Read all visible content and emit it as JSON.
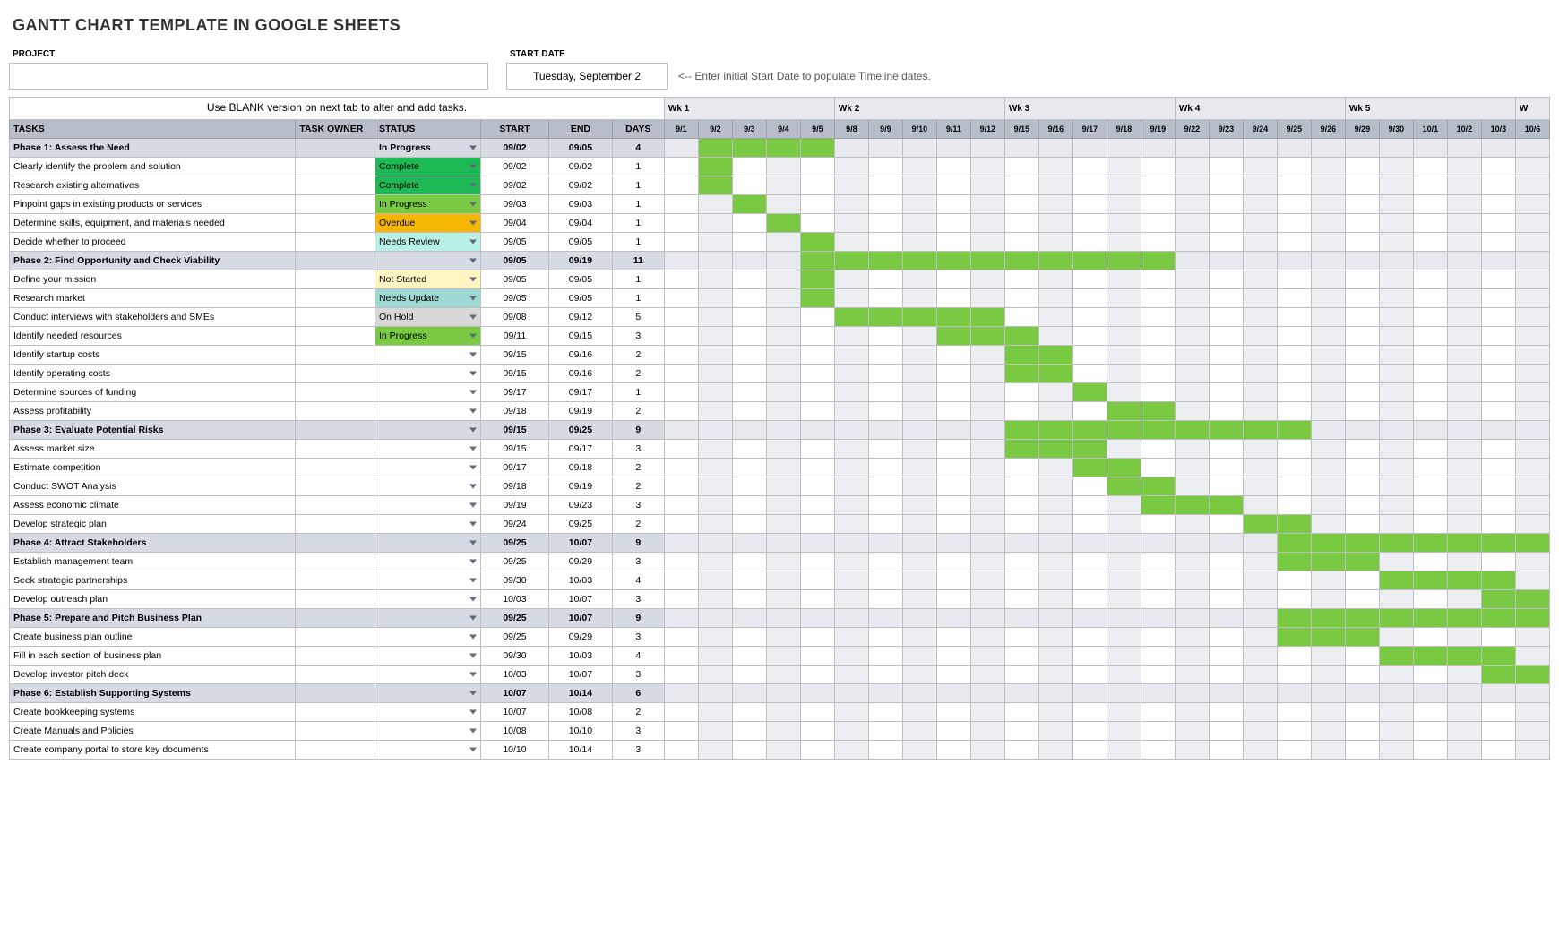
{
  "title": "GANTT CHART TEMPLATE IN GOOGLE SHEETS",
  "labels": {
    "project": "PROJECT",
    "start_date": "START DATE",
    "date_value": "Tuesday, September 2",
    "hint": "<-- Enter initial Start Date to populate Timeline dates.",
    "instructions": "Use BLANK version on next tab to alter and add tasks.",
    "tasks": "TASKS",
    "task_owner": "TASK OWNER",
    "status": "STATUS",
    "start": "START",
    "end": "END",
    "days": "DAYS"
  },
  "status_colors": {
    "In Progress": "s-inprogress",
    "Complete": "s-complete",
    "Overdue": "s-overdue",
    "Needs Review": "s-needsreview",
    "Not Started": "s-notstarted",
    "Needs Update": "s-needsupdate",
    "On Hold": "s-onhold",
    "": "s-empty"
  },
  "weeks": [
    {
      "label": "Wk 1",
      "days": [
        "9/1",
        "9/2",
        "9/3",
        "9/4",
        "9/5"
      ]
    },
    {
      "label": "Wk 2",
      "days": [
        "9/8",
        "9/9",
        "9/10",
        "9/11",
        "9/12"
      ]
    },
    {
      "label": "Wk 3",
      "days": [
        "9/15",
        "9/16",
        "9/17",
        "9/18",
        "9/19"
      ]
    },
    {
      "label": "Wk 4",
      "days": [
        "9/22",
        "9/23",
        "9/24",
        "9/25",
        "9/26"
      ]
    },
    {
      "label": "Wk 5",
      "days": [
        "9/29",
        "9/30",
        "10/1",
        "10/2",
        "10/3"
      ]
    },
    {
      "label": "W",
      "days": [
        "1"
      ]
    }
  ],
  "timeline_dates": [
    "9/1",
    "9/2",
    "9/3",
    "9/4",
    "9/5",
    "9/8",
    "9/9",
    "9/10",
    "9/11",
    "9/12",
    "9/15",
    "9/16",
    "9/17",
    "9/18",
    "9/19",
    "9/22",
    "9/23",
    "9/24",
    "9/25",
    "9/26",
    "9/29",
    "9/30",
    "10/1",
    "10/2",
    "10/3",
    "10/6"
  ],
  "rows": [
    {
      "type": "phase",
      "task": "Phase 1: Assess the Need",
      "status": "In Progress",
      "start": "09/02",
      "end": "09/05",
      "days": "4",
      "bar_start": "9/2",
      "bar_end": "9/5"
    },
    {
      "type": "task",
      "task": "Clearly identify the problem and solution",
      "status": "Complete",
      "start": "09/02",
      "end": "09/02",
      "days": "1",
      "bar_start": "9/2",
      "bar_end": "9/2"
    },
    {
      "type": "task",
      "task": "Research existing alternatives",
      "status": "Complete",
      "start": "09/02",
      "end": "09/02",
      "days": "1",
      "bar_start": "9/2",
      "bar_end": "9/2"
    },
    {
      "type": "task",
      "task": "Pinpoint gaps in existing products or services",
      "status": "In Progress",
      "start": "09/03",
      "end": "09/03",
      "days": "1",
      "bar_start": "9/3",
      "bar_end": "9/3"
    },
    {
      "type": "task",
      "task": "Determine skills, equipment, and materials needed",
      "status": "Overdue",
      "start": "09/04",
      "end": "09/04",
      "days": "1",
      "bar_start": "9/4",
      "bar_end": "9/4"
    },
    {
      "type": "task",
      "task": "Decide whether to proceed",
      "status": "Needs Review",
      "start": "09/05",
      "end": "09/05",
      "days": "1",
      "bar_start": "9/5",
      "bar_end": "9/5"
    },
    {
      "type": "phase",
      "task": "Phase 2: Find Opportunity and Check Viability",
      "status": "",
      "start": "09/05",
      "end": "09/19",
      "days": "11",
      "bar_start": "9/5",
      "bar_end": "9/19"
    },
    {
      "type": "task",
      "task": "Define your mission",
      "status": "Not Started",
      "start": "09/05",
      "end": "09/05",
      "days": "1",
      "bar_start": "9/5",
      "bar_end": "9/5"
    },
    {
      "type": "task",
      "task": "Research market",
      "status": "Needs Update",
      "start": "09/05",
      "end": "09/05",
      "days": "1",
      "bar_start": "9/5",
      "bar_end": "9/5"
    },
    {
      "type": "task",
      "task": "Conduct interviews with stakeholders and SMEs",
      "status": "On Hold",
      "start": "09/08",
      "end": "09/12",
      "days": "5",
      "bar_start": "9/8",
      "bar_end": "9/12"
    },
    {
      "type": "task",
      "task": "Identify needed resources",
      "status": "In Progress",
      "start": "09/11",
      "end": "09/15",
      "days": "3",
      "bar_start": "9/11",
      "bar_end": "9/15"
    },
    {
      "type": "task",
      "task": "Identify startup costs",
      "status": "",
      "start": "09/15",
      "end": "09/16",
      "days": "2",
      "bar_start": "9/15",
      "bar_end": "9/16"
    },
    {
      "type": "task",
      "task": "Identify operating costs",
      "status": "",
      "start": "09/15",
      "end": "09/16",
      "days": "2",
      "bar_start": "9/15",
      "bar_end": "9/16"
    },
    {
      "type": "task",
      "task": "Determine sources of funding",
      "status": "",
      "start": "09/17",
      "end": "09/17",
      "days": "1",
      "bar_start": "9/17",
      "bar_end": "9/17"
    },
    {
      "type": "task",
      "task": "Assess profitability",
      "status": "",
      "start": "09/18",
      "end": "09/19",
      "days": "2",
      "bar_start": "9/18",
      "bar_end": "9/19"
    },
    {
      "type": "phase",
      "task": "Phase 3: Evaluate Potential Risks",
      "status": "",
      "start": "09/15",
      "end": "09/25",
      "days": "9",
      "bar_start": "9/15",
      "bar_end": "9/25"
    },
    {
      "type": "task",
      "task": "Assess market size",
      "status": "",
      "start": "09/15",
      "end": "09/17",
      "days": "3",
      "bar_start": "9/15",
      "bar_end": "9/17"
    },
    {
      "type": "task",
      "task": "Estimate competition",
      "status": "",
      "start": "09/17",
      "end": "09/18",
      "days": "2",
      "bar_start": "9/17",
      "bar_end": "9/18"
    },
    {
      "type": "task",
      "task": "Conduct SWOT Analysis",
      "status": "",
      "start": "09/18",
      "end": "09/19",
      "days": "2",
      "bar_start": "9/18",
      "bar_end": "9/19"
    },
    {
      "type": "task",
      "task": "Assess economic climate",
      "status": "",
      "start": "09/19",
      "end": "09/23",
      "days": "3",
      "bar_start": "9/19",
      "bar_end": "9/23"
    },
    {
      "type": "task",
      "task": "Develop strategic plan",
      "status": "",
      "start": "09/24",
      "end": "09/25",
      "days": "2",
      "bar_start": "9/24",
      "bar_end": "9/25"
    },
    {
      "type": "phase",
      "task": "Phase 4: Attract Stakeholders",
      "status": "",
      "start": "09/25",
      "end": "10/07",
      "days": "9",
      "bar_start": "9/25",
      "bar_end": "10/6"
    },
    {
      "type": "task",
      "task": "Establish management team",
      "status": "",
      "start": "09/25",
      "end": "09/29",
      "days": "3",
      "bar_start": "9/25",
      "bar_end": "9/29"
    },
    {
      "type": "task",
      "task": "Seek strategic partnerships",
      "status": "",
      "start": "09/30",
      "end": "10/03",
      "days": "4",
      "bar_start": "9/30",
      "bar_end": "10/3"
    },
    {
      "type": "task",
      "task": "Develop outreach plan",
      "status": "",
      "start": "10/03",
      "end": "10/07",
      "days": "3",
      "bar_start": "10/3",
      "bar_end": "10/6"
    },
    {
      "type": "phase",
      "task": "Phase 5: Prepare and Pitch Business Plan",
      "status": "",
      "start": "09/25",
      "end": "10/07",
      "days": "9",
      "bar_start": "9/25",
      "bar_end": "10/6"
    },
    {
      "type": "task",
      "task": "Create business plan outline",
      "status": "",
      "start": "09/25",
      "end": "09/29",
      "days": "3",
      "bar_start": "9/25",
      "bar_end": "9/29"
    },
    {
      "type": "task",
      "task": "Fill in each section of business plan",
      "status": "",
      "start": "09/30",
      "end": "10/03",
      "days": "4",
      "bar_start": "9/30",
      "bar_end": "10/3"
    },
    {
      "type": "task",
      "task": "Develop investor pitch deck",
      "status": "",
      "start": "10/03",
      "end": "10/07",
      "days": "3",
      "bar_start": "10/3",
      "bar_end": "10/6"
    },
    {
      "type": "phase",
      "task": "Phase 6: Establish Supporting Systems",
      "status": "",
      "start": "10/07",
      "end": "10/14",
      "days": "6",
      "bar_start": "",
      "bar_end": ""
    },
    {
      "type": "task",
      "task": "Create bookkeeping systems",
      "status": "",
      "start": "10/07",
      "end": "10/08",
      "days": "2",
      "bar_start": "",
      "bar_end": ""
    },
    {
      "type": "task",
      "task": "Create Manuals and Policies",
      "status": "",
      "start": "10/08",
      "end": "10/10",
      "days": "3",
      "bar_start": "",
      "bar_end": ""
    },
    {
      "type": "task",
      "task": "Create company portal to store key documents",
      "status": "",
      "start": "10/10",
      "end": "10/14",
      "days": "3",
      "bar_start": "",
      "bar_end": ""
    }
  ]
}
